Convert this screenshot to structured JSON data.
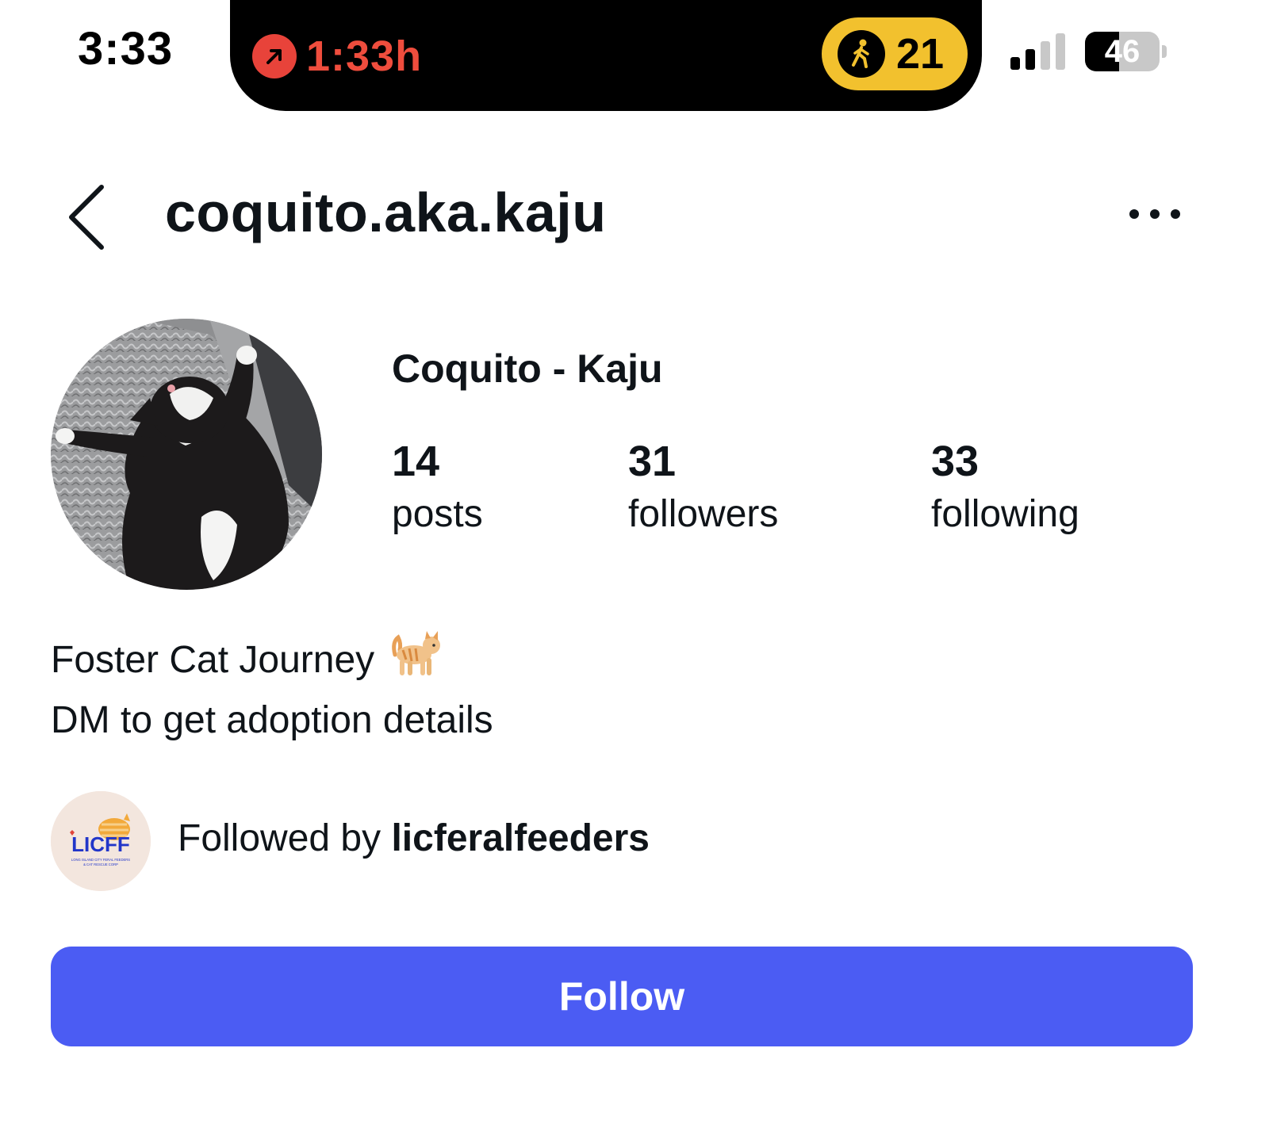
{
  "status_bar": {
    "time": "3:33",
    "timer": "1:33h",
    "steps": "21",
    "battery": "46",
    "battery_level": 0.46
  },
  "header": {
    "username": "coquito.aka.kaju",
    "back_icon": "chevron-left-icon",
    "more_icon": "more-horizontal-icon"
  },
  "profile": {
    "display_name": "Coquito - Kaju",
    "stats": [
      {
        "count": "14",
        "label": "posts"
      },
      {
        "count": "31",
        "label": "followers"
      },
      {
        "count": "33",
        "label": "following"
      }
    ],
    "bio": {
      "line1": "Foster Cat Journey",
      "emoji": "🐈",
      "line2": "DM to get adoption details"
    },
    "followed_by": {
      "prefix": "Followed by ",
      "account": "licferalfeeders",
      "avatar_logo_text": "LICFF",
      "avatar_logo_subtext": "LONG ISLAND CITY FERAL FEEDERS & CAT RESCUE CORP"
    }
  },
  "actions": {
    "follow_label": "Follow"
  },
  "colors": {
    "accent": "#4b5cf3",
    "timer_red": "#ef4d3d",
    "steps_yellow": "#f2c12e"
  }
}
